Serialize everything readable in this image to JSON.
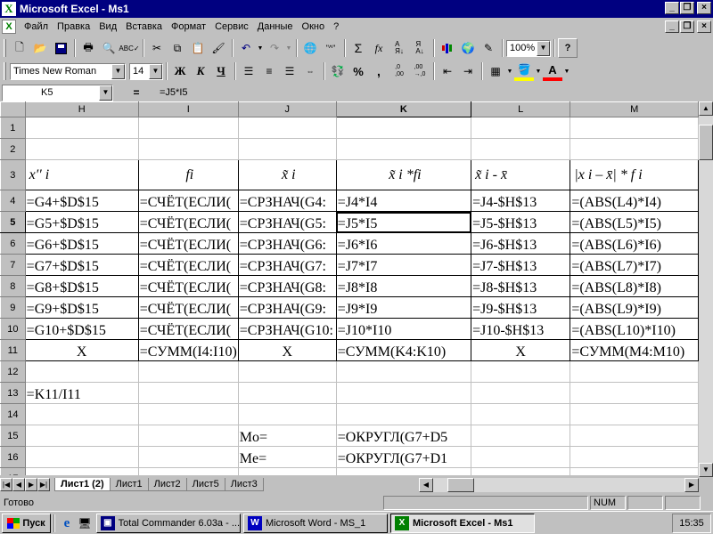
{
  "app": {
    "title": "Microsoft Excel - Ms1",
    "logo_letter": "X"
  },
  "menu": {
    "items": [
      "Файл",
      "Правка",
      "Вид",
      "Вставка",
      "Формат",
      "Сервис",
      "Данные",
      "Окно",
      "?"
    ]
  },
  "toolbar": {
    "icons": [
      "new-icon",
      "open-icon",
      "save-icon",
      "print-icon",
      "print-preview-icon",
      "spelling-icon",
      "cut-icon",
      "copy-icon",
      "paste-icon",
      "format-painter-icon",
      "undo-icon",
      "redo-icon",
      "hyperlink-icon",
      "web-toolbar-icon",
      "autosum-icon",
      "function-icon",
      "sort-ascending-icon",
      "sort-descending-icon",
      "chart-wizard-icon",
      "map-icon",
      "drawing-icon",
      "help-icon"
    ],
    "zoom": "100%"
  },
  "format_toolbar": {
    "font": "Times New Roman",
    "size": "14",
    "bold": "Ж",
    "italic": "К",
    "underline": "Ч",
    "percent": "%",
    "comma": ","
  },
  "formula_bar": {
    "name_box": "K5",
    "equals": "=",
    "formula": "=J5*I5"
  },
  "grid": {
    "columns": [
      "H",
      "I",
      "J",
      "K",
      "L",
      "M"
    ],
    "selected_column": "K",
    "selected_row": "5",
    "rows": [
      {
        "n": "1",
        "cells": [
          "",
          "",
          "",
          "",
          "",
          ""
        ]
      },
      {
        "n": "2",
        "cells": [
          "",
          "",
          "",
          "",
          "",
          ""
        ]
      },
      {
        "n": "3",
        "cells": [
          "",
          "",
          "",
          "",
          "",
          ""
        ]
      },
      {
        "n": "4",
        "cells": [
          "=G4+$D$15",
          "=СЧЁТ(ЕСЛИ(",
          "=СРЗНАЧ(G4:",
          "=J4*I4",
          "=J4-$H$13",
          "=(ABS(L4)*I4)"
        ]
      },
      {
        "n": "5",
        "cells": [
          "=G5+$D$15",
          "=СЧЁТ(ЕСЛИ(",
          "=СРЗНАЧ(G5:",
          "=J5*I5",
          "=J5-$H$13",
          "=(ABS(L5)*I5)"
        ]
      },
      {
        "n": "6",
        "cells": [
          "=G6+$D$15",
          "=СЧЁТ(ЕСЛИ(",
          "=СРЗНАЧ(G6:",
          "=J6*I6",
          "=J6-$H$13",
          "=(ABS(L6)*I6)"
        ]
      },
      {
        "n": "7",
        "cells": [
          "=G7+$D$15",
          "=СЧЁТ(ЕСЛИ(",
          "=СРЗНАЧ(G7:",
          "=J7*I7",
          "=J7-$H$13",
          "=(ABS(L7)*I7)"
        ]
      },
      {
        "n": "8",
        "cells": [
          "=G8+$D$15",
          "=СЧЁТ(ЕСЛИ(",
          "=СРЗНАЧ(G8:",
          "=J8*I8",
          "=J8-$H$13",
          "=(ABS(L8)*I8)"
        ]
      },
      {
        "n": "9",
        "cells": [
          "=G9+$D$15",
          "=СЧЁТ(ЕСЛИ(",
          "=СРЗНАЧ(G9:",
          "=J9*I9",
          "=J9-$H$13",
          "=(ABS(L9)*I9)"
        ]
      },
      {
        "n": "10",
        "cells": [
          "=G10+$D$15",
          "=СЧЁТ(ЕСЛИ(",
          "=СРЗНАЧ(G10:",
          "=J10*I10",
          "=J10-$H$13",
          "=(ABS(L10)*I10)"
        ]
      },
      {
        "n": "11",
        "cells": [
          "X",
          "=СУММ(I4:I10)",
          "X",
          "=СУММ(K4:K10)",
          "X",
          "=СУММ(M4:M10)"
        ]
      },
      {
        "n": "12",
        "cells": [
          "",
          "",
          "",
          "",
          "",
          ""
        ]
      },
      {
        "n": "13",
        "cells": [
          "=K11/I11",
          "",
          "",
          "",
          "",
          ""
        ]
      },
      {
        "n": "14",
        "cells": [
          "",
          "",
          "",
          "",
          "",
          ""
        ]
      },
      {
        "n": "15",
        "cells": [
          "",
          "",
          "Mo=",
          "=ОКРУГЛ(G7+D5",
          "",
          ""
        ]
      },
      {
        "n": "16",
        "cells": [
          "",
          "",
          "Me=",
          "=ОКРУГЛ(G7+D1",
          "",
          ""
        ]
      },
      {
        "n": "17",
        "cells": [
          "",
          "",
          "",
          "",
          "",
          ""
        ]
      },
      {
        "n": "18",
        "cells": [
          "",
          "",
          "",
          "",
          "",
          ""
        ]
      }
    ],
    "header_row": {
      "H": "x′′ i",
      "I": "fi",
      "J": "x̃ i",
      "K": "x̃ i *fi",
      "L": "x̃ i  -  x̄",
      "M": "|x i  –  x̄| *  f i"
    }
  },
  "sheets": {
    "tabs": [
      "Лист1 (2)",
      "Лист1",
      "Лист2",
      "Лист5",
      "Лист3"
    ],
    "active": "Лист1 (2)"
  },
  "status": {
    "text": "Готово",
    "num": "NUM"
  },
  "taskbar": {
    "start": "Пуск",
    "tasks": [
      {
        "label": "Total Commander 6.03a - ...",
        "icon": "total-commander-icon",
        "color": "#000080"
      },
      {
        "label": "Microsoft Word - MS_1",
        "icon": "word-icon",
        "color": "#0000c0"
      },
      {
        "label": "Microsoft Excel - Ms1",
        "icon": "excel-icon",
        "color": "#008000"
      }
    ],
    "active_task": "Microsoft Excel - Ms1",
    "clock": "15:35"
  }
}
